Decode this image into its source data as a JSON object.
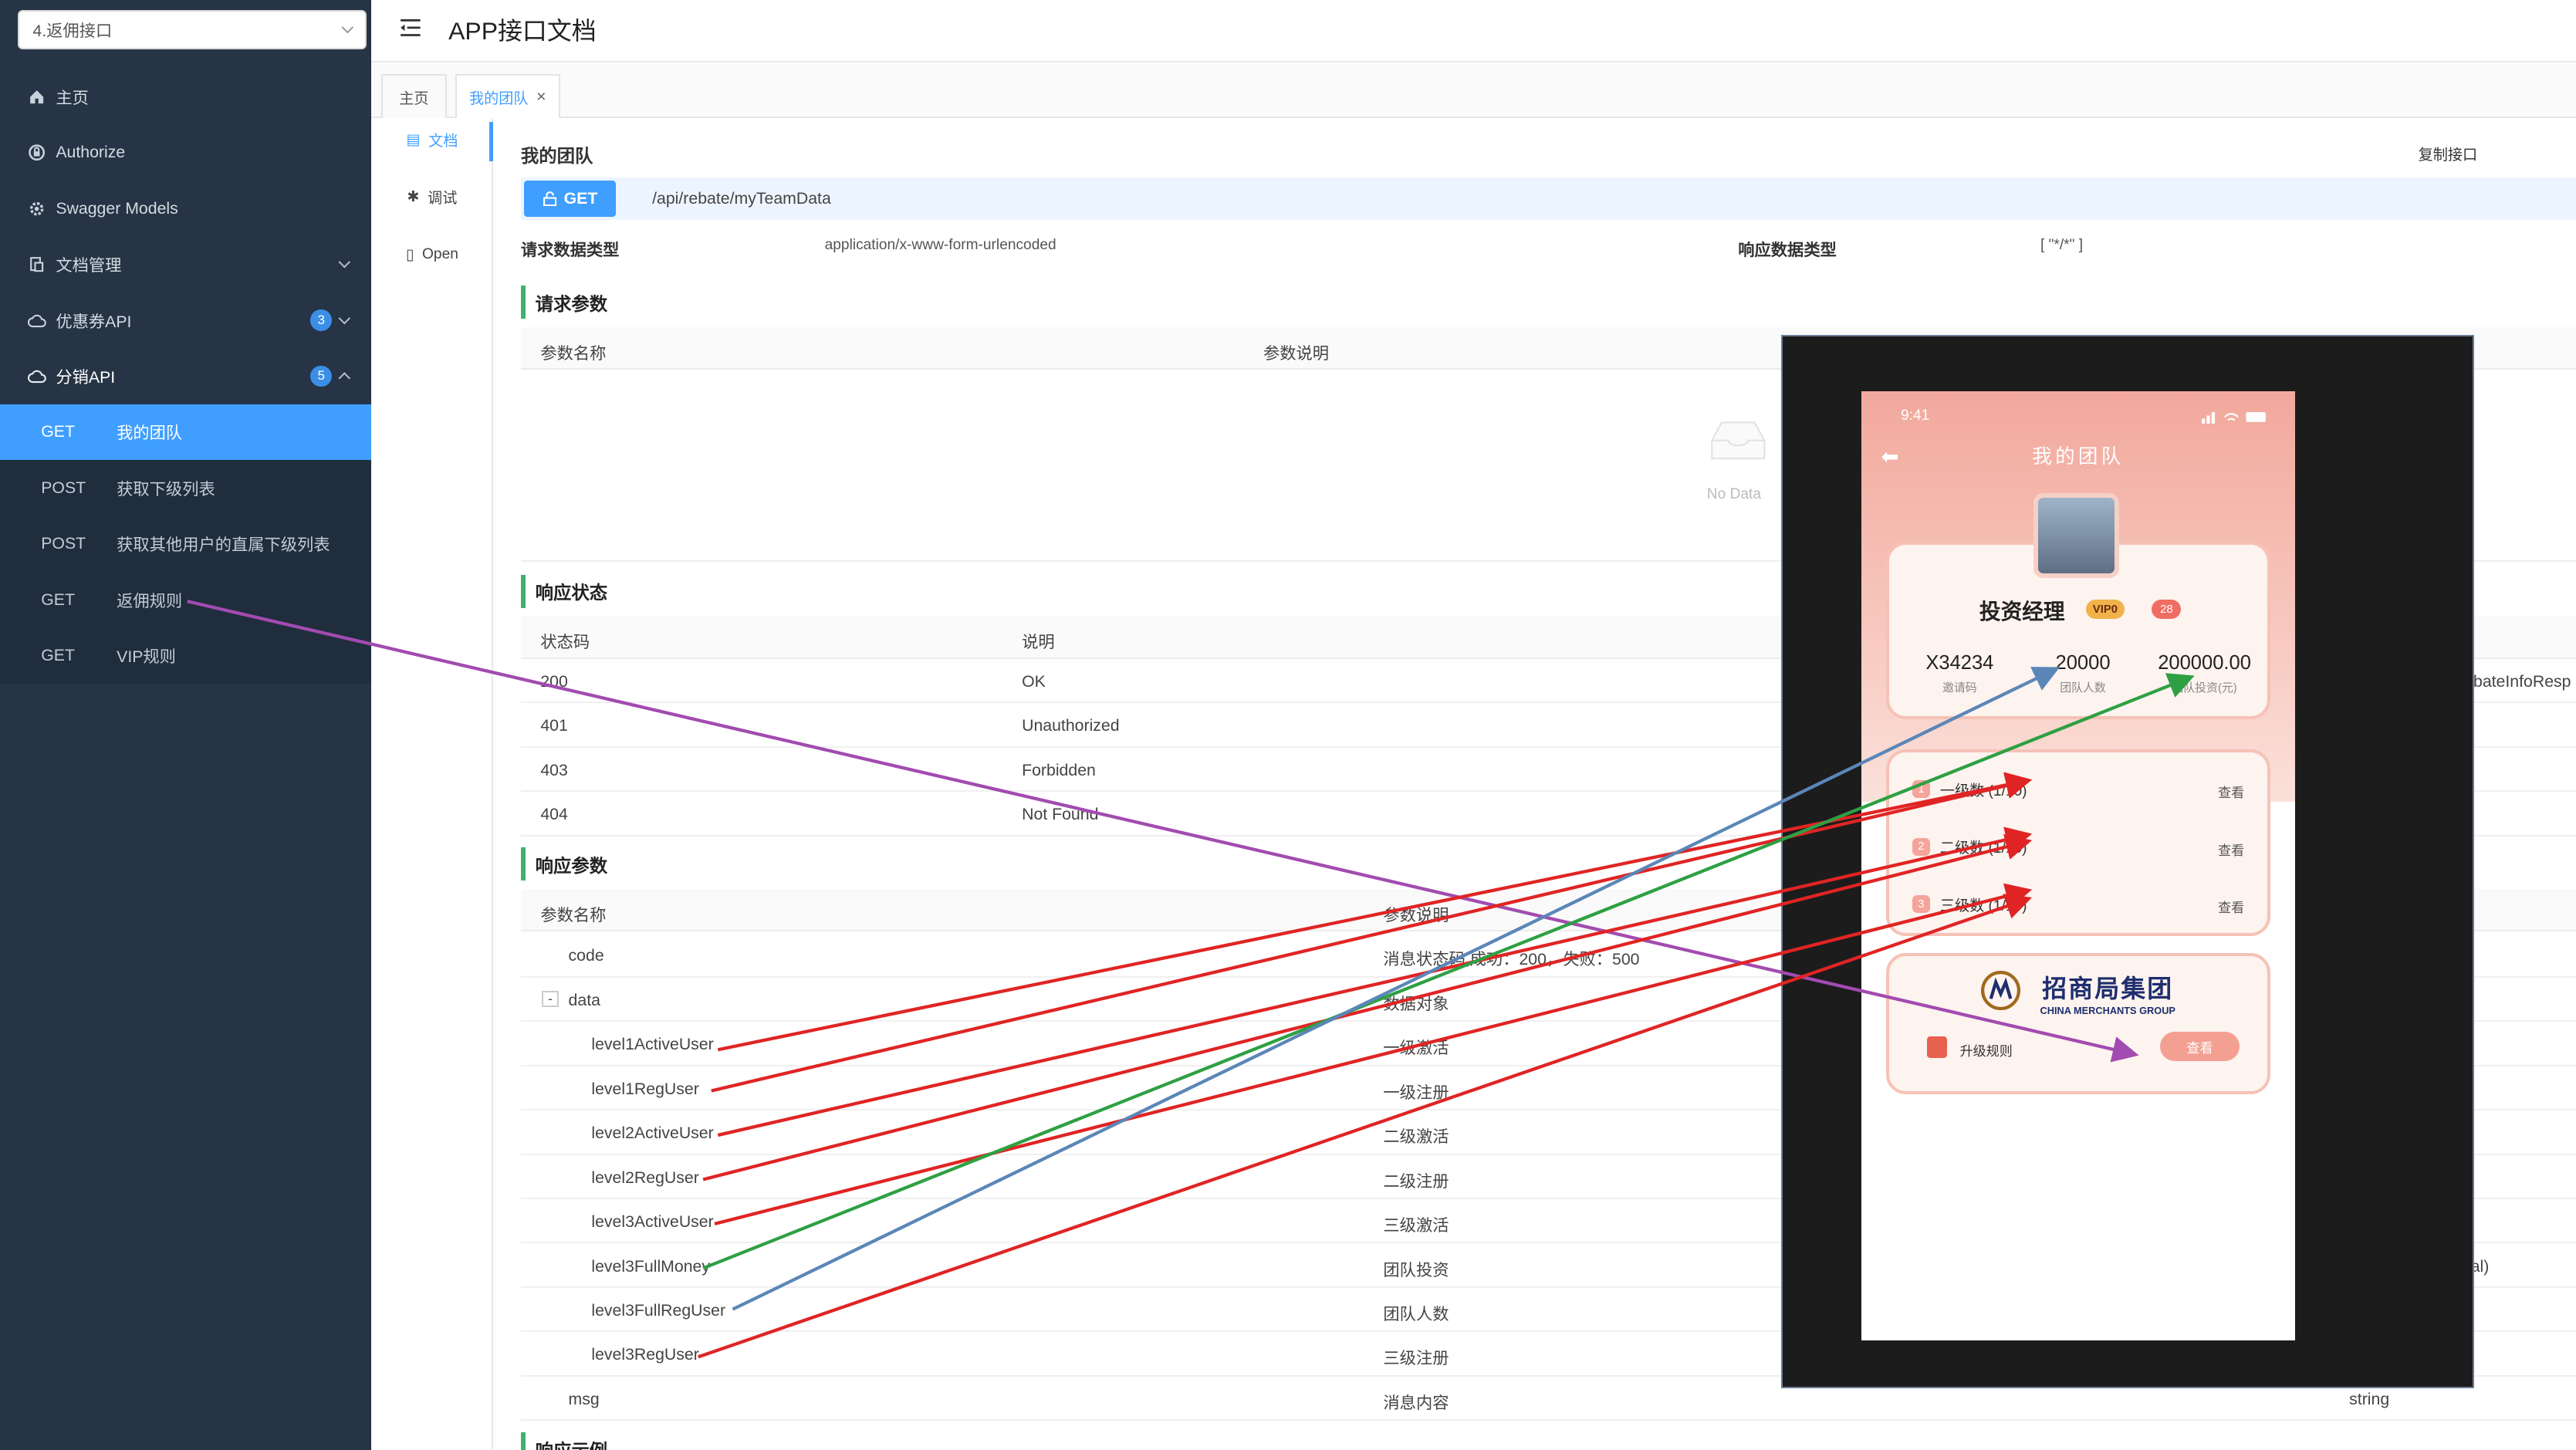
{
  "sidebar": {
    "group_select": "4.返佣接口",
    "items": [
      {
        "label": "主页"
      },
      {
        "label": "Authorize"
      },
      {
        "label": "Swagger Models"
      },
      {
        "label": "文档管理"
      },
      {
        "label": "优惠券API",
        "count": "3"
      },
      {
        "label": "分销API",
        "count": "5"
      }
    ],
    "sub_items": [
      {
        "method": "GET",
        "label": "我的团队"
      },
      {
        "method": "POST",
        "label": "获取下级列表"
      },
      {
        "method": "POST",
        "label": "获取其他用户的直属下级列表"
      },
      {
        "method": "GET",
        "label": "返佣规则"
      },
      {
        "method": "GET",
        "label": "VIP规则"
      }
    ]
  },
  "header": {
    "title": "APP接口文档"
  },
  "tabs": [
    {
      "label": "主页"
    },
    {
      "label": "我的团队"
    }
  ],
  "doc_nav": [
    {
      "label": "文档"
    },
    {
      "label": "调试"
    },
    {
      "label": "Open"
    }
  ],
  "api": {
    "name": "我的团队",
    "copy_label": "复制接口",
    "method": "GET",
    "path": "/api/rebate/myTeamData",
    "req_type_label": "请求数据类型",
    "req_type": "application/x-www-form-urlencoded",
    "resp_type_label": "响应数据类型",
    "resp_type": "[ \"*/*\" ]"
  },
  "request_params": {
    "title": "请求参数",
    "col_name": "参数名称",
    "col_desc": "参数说明",
    "empty": "No Data"
  },
  "response_status": {
    "title": "响应状态",
    "col_code": "状态码",
    "col_desc": "说明",
    "rows": [
      {
        "code": "200",
        "desc": "OK"
      },
      {
        "code": "401",
        "desc": "Unauthorized"
      },
      {
        "code": "403",
        "desc": "Forbidden"
      },
      {
        "code": "404",
        "desc": "Not Found"
      }
    ],
    "schema_tail": "ebateInfoResp"
  },
  "response_params": {
    "title": "响应参数",
    "col_name": "参数名称",
    "col_desc": "参数说明",
    "rows": [
      {
        "name": "code",
        "desc": "消息状态码,成功：200，失败：500"
      },
      {
        "name": "data",
        "desc": "数据对象",
        "toggle": "-"
      },
      {
        "name": "level1ActiveUser",
        "desc": "一级激活"
      },
      {
        "name": "level1RegUser",
        "desc": "一级注册"
      },
      {
        "name": "level2ActiveUser",
        "desc": "二级激活"
      },
      {
        "name": "level2RegUser",
        "desc": "二级注册"
      },
      {
        "name": "level3ActiveUser",
        "desc": "三级激活"
      },
      {
        "name": "level3FullMoney",
        "desc": "团队投资",
        "extra": "al)"
      },
      {
        "name": "level3FullRegUser",
        "desc": "团队人数"
      },
      {
        "name": "level3RegUser",
        "desc": "三级注册"
      },
      {
        "name": "msg",
        "desc": "消息内容",
        "type": "string"
      }
    ],
    "next_title": "响应示例"
  },
  "phone": {
    "time": "9:41",
    "title": "我的团队",
    "role": "投资经理",
    "vip_badge": "VIP0",
    "tag": "28",
    "invite_code": "X34234",
    "invite_label": "邀请码",
    "team_count": "20000",
    "team_count_label": "团队人数",
    "team_invest": "200000.00",
    "team_invest_label": "团队投资(元)",
    "levels": [
      {
        "num": "1",
        "label": "一级数 (1/10)",
        "action": "查看"
      },
      {
        "num": "2",
        "label": "二级数 (1/10)",
        "action": "查看"
      },
      {
        "num": "3",
        "label": "三级数 (1/10)",
        "action": "查看"
      }
    ],
    "brand_zh": "招商局集团",
    "brand_en": "CHINA MERCHANTS GROUP",
    "upgrade_label": "升级规则",
    "upgrade_action": "查看"
  },
  "colors": {
    "sidebar_bg": "#263445",
    "accent": "#409eff",
    "section_bar": "#3cb371",
    "arrow_red": "#e02424",
    "arrow_green": "#2ea043",
    "arrow_blue": "#5b86b8",
    "arrow_purple": "#a24bb0"
  }
}
